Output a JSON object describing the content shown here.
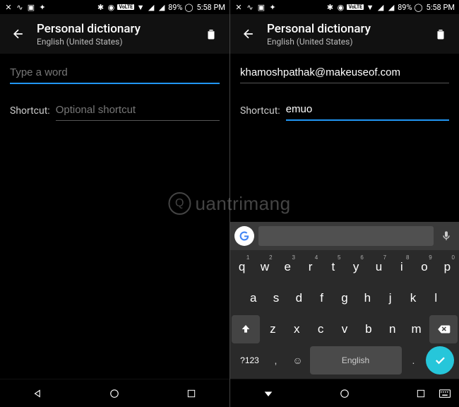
{
  "status": {
    "battery": "89%",
    "time": "5:58 PM",
    "volte": "VoLTE"
  },
  "appbar": {
    "title": "Personal dictionary",
    "subtitle": "English (United States)"
  },
  "left": {
    "word_placeholder": "Type a word",
    "word_value": "",
    "shortcut_label": "Shortcut:",
    "shortcut_placeholder": "Optional shortcut",
    "shortcut_value": ""
  },
  "right": {
    "word_value": "khamoshpathak@makeuseof.com",
    "shortcut_label": "Shortcut:",
    "shortcut_value": "emuo"
  },
  "keyboard": {
    "row1": [
      {
        "k": "q",
        "n": "1"
      },
      {
        "k": "w",
        "n": "2"
      },
      {
        "k": "e",
        "n": "3"
      },
      {
        "k": "r",
        "n": "4"
      },
      {
        "k": "t",
        "n": "5"
      },
      {
        "k": "y",
        "n": "6"
      },
      {
        "k": "u",
        "n": "7"
      },
      {
        "k": "i",
        "n": "8"
      },
      {
        "k": "o",
        "n": "9"
      },
      {
        "k": "p",
        "n": "0"
      }
    ],
    "row2": [
      "a",
      "s",
      "d",
      "f",
      "g",
      "h",
      "j",
      "k",
      "l"
    ],
    "row3": [
      "z",
      "x",
      "c",
      "v",
      "b",
      "n",
      "m"
    ],
    "sym": "?123",
    "space": "English",
    "comma": ",",
    "period": "."
  },
  "watermark": "uantrimang"
}
